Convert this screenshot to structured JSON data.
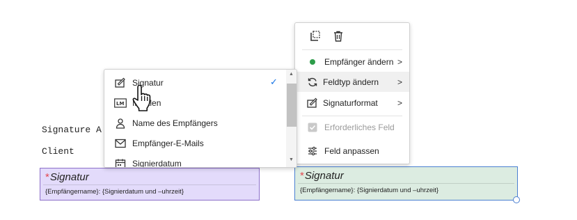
{
  "document": {
    "line1": "Signature A",
    "line2": "Client"
  },
  "fields": {
    "left": {
      "required_mark": "*",
      "title": "Signatur",
      "subtitle": "{Empfängername}: {Signierdatum und –uhrzeit}",
      "bg": "#e3dbfb",
      "border": "#8c6fc9"
    },
    "right": {
      "required_mark": "*",
      "title": "Signatur",
      "subtitle": "{Empfängername}: {Signierdatum und –uhrzeit}",
      "bg": "#dcece1",
      "border": "#4a7fd1"
    }
  },
  "context_menu": {
    "items": [
      {
        "label": "Empfänger ändern",
        "icon": "green-dot-icon",
        "has_submenu": true
      },
      {
        "label": "Feldtyp ändern",
        "icon": "refresh-icon",
        "has_submenu": true
      },
      {
        "label": "Signaturformat",
        "icon": "signature-pen-icon",
        "has_submenu": true
      },
      {
        "label": "Erforderliches Feld",
        "icon": "checkbox-icon",
        "disabled": true
      },
      {
        "label": "Feld anpassen",
        "icon": "sliders-icon"
      }
    ],
    "chevron": ">"
  },
  "field_type_submenu": {
    "items": [
      {
        "label": "Signatur",
        "icon": "signature-pen-icon",
        "selected": true
      },
      {
        "label": "Initialen",
        "icon": "initials-icon"
      },
      {
        "label": "Name des Empfängers",
        "icon": "person-icon"
      },
      {
        "label": "Empfänger-E-Mails",
        "icon": "envelope-icon"
      },
      {
        "label": "Signierdatum",
        "icon": "calendar-icon"
      }
    ],
    "check": "✓",
    "scroll_up": "▲",
    "scroll_down": "▼"
  },
  "colors": {
    "accent": "#1473e6",
    "green_dot": "#2d9d4a",
    "required": "#e34850"
  }
}
